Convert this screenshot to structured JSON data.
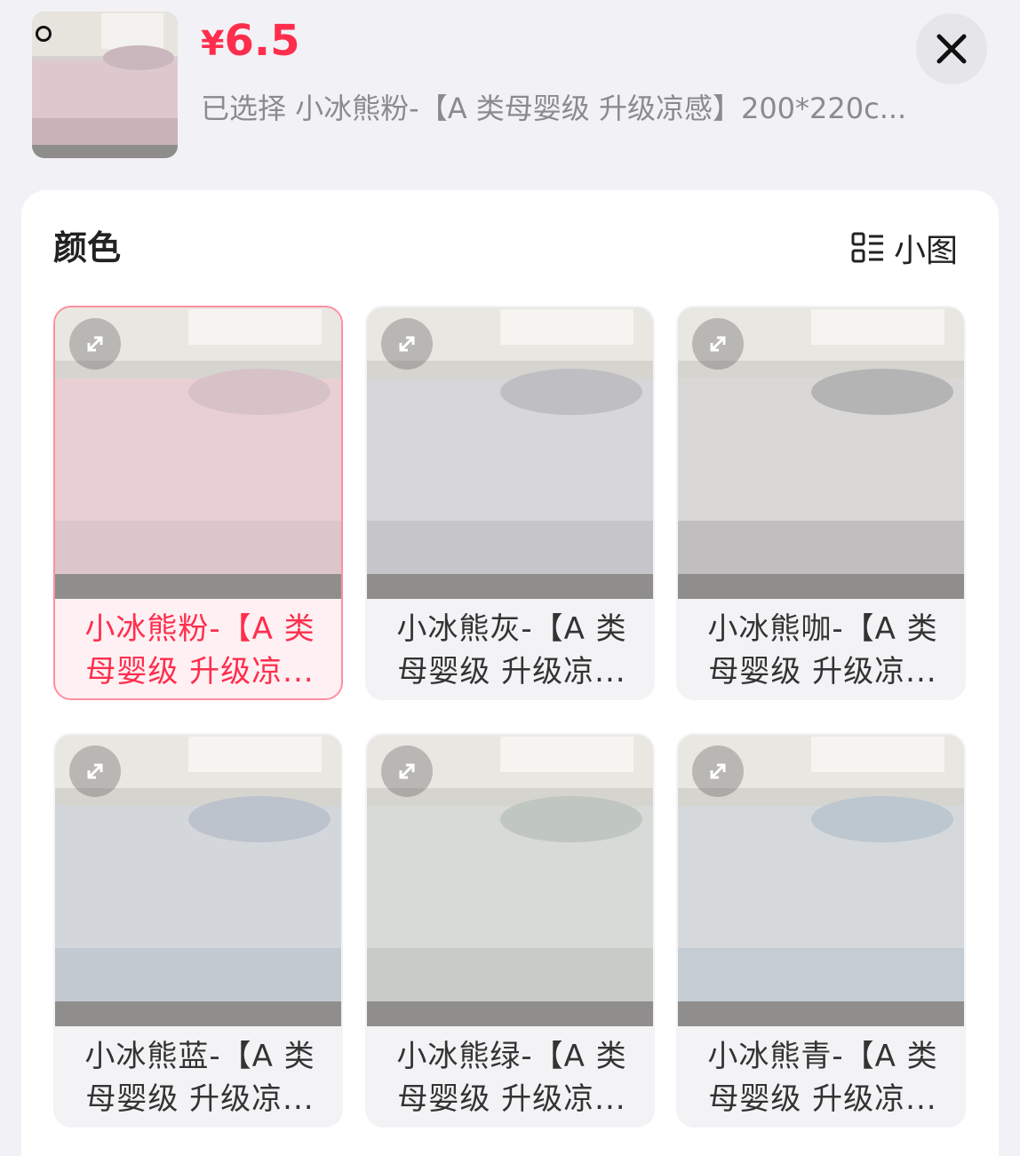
{
  "header": {
    "price_symbol": "¥",
    "price_value": "6.5",
    "selected_text": "已选择 小冰熊粉-【A 类母婴级 升级凉感】200*220c...",
    "close_icon": "close-icon",
    "thumb_icon": "product-thumbnail"
  },
  "section": {
    "title": "颜色",
    "view_toggle_label": "小图",
    "view_toggle_icon": "list-view-icon"
  },
  "colors": {
    "accent": "#ff2e4d",
    "selected_border": "#ff8fa0",
    "background": "#f2f2f6"
  },
  "options": [
    {
      "label": "小冰熊粉-【A 类母婴级 升级凉...",
      "selected": true,
      "tint": "#e8cfd3",
      "pillow": "#d7c2c8"
    },
    {
      "label": "小冰熊灰-【A 类母婴级 升级凉...",
      "selected": false,
      "tint": "#d7d7d9",
      "pillow": "#bfbfc3"
    },
    {
      "label": "小冰熊咖-【A 类母婴级 升级凉...",
      "selected": false,
      "tint": "#d9d8d6",
      "pillow": "#b5b4b5"
    },
    {
      "label": "小冰熊蓝-【A 类母婴级 升级凉...",
      "selected": false,
      "tint": "#d3d7dc",
      "pillow": "#bcc3cc"
    },
    {
      "label": "小冰熊绿-【A 类母婴级 升级凉...",
      "selected": false,
      "tint": "#d7dad7",
      "pillow": "#c0c6c0"
    },
    {
      "label": "小冰熊青-【A 类母婴级 升级凉...",
      "selected": false,
      "tint": "#d5d9dc",
      "pillow": "#bcc7cf"
    }
  ]
}
